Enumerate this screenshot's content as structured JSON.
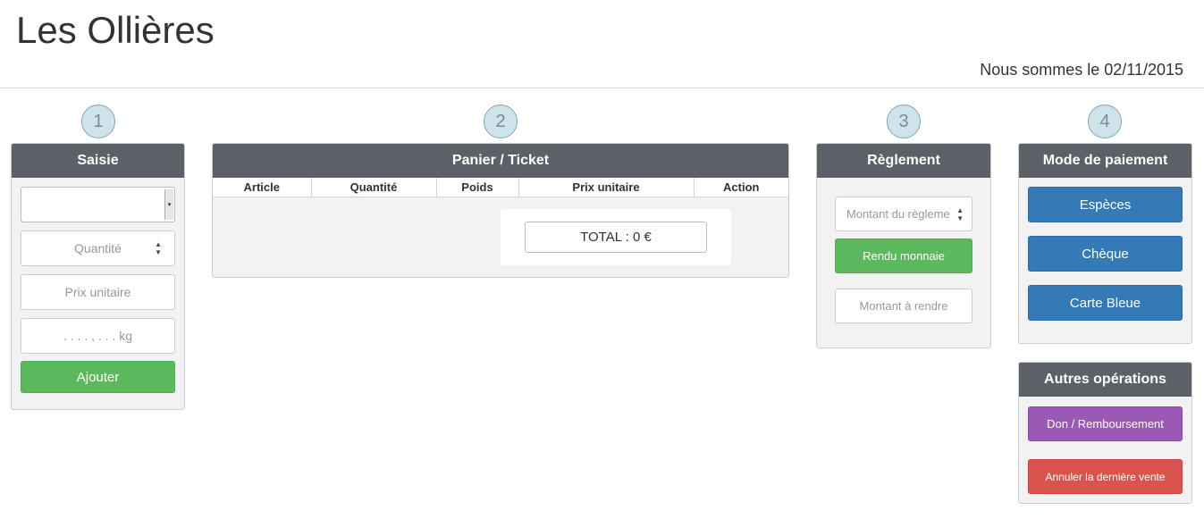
{
  "header": {
    "title": "Les Ollières",
    "date_text": "Nous sommes le 02/11/2015"
  },
  "steps": [
    "1",
    "2",
    "3",
    "4"
  ],
  "saisie": {
    "title": "Saisie",
    "select_value": "",
    "quantity_placeholder": "Quantité",
    "unit_price_placeholder": "Prix unitaire",
    "weight_placeholder": ". . . . , . . . kg",
    "add_label": "Ajouter"
  },
  "cart": {
    "title": "Panier / Ticket",
    "columns": [
      "Article",
      "Quantité",
      "Poids",
      "Prix unitaire",
      "Action"
    ],
    "rows": [],
    "total_text": "TOTAL : 0 €"
  },
  "reglement": {
    "title": "Règlement",
    "amount_placeholder": "Montant du règleme",
    "change_label": "Rendu monnaie",
    "to_return_placeholder": "Montant à rendre"
  },
  "payment": {
    "title": "Mode de paiement",
    "methods": [
      "Espèces",
      "Chèque",
      "Carte Bleue"
    ]
  },
  "other": {
    "title": "Autres opérations",
    "donation_label": "Don / Remboursement",
    "cancel_label": "Annuler la dernière vente"
  }
}
